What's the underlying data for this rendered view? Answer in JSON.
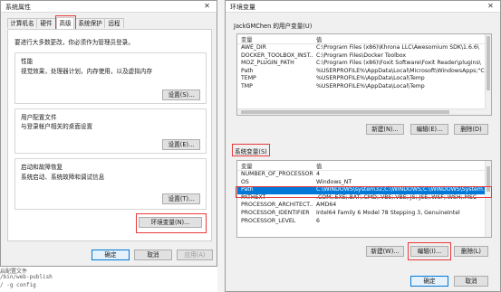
{
  "sysprops": {
    "title": "系统属性",
    "close_glyph": "✕",
    "tabs": [
      "计算机名",
      "硬件",
      "高级",
      "系统保护",
      "远程"
    ],
    "admin_note": "要进行大多数更改，你必须作为管理员登录。",
    "performance": {
      "title": "性能",
      "desc": "视觉效果，处理器计划，内存使用，以及虚拟内存",
      "button": "设置(S)..."
    },
    "profile": {
      "title": "用户配置文件",
      "desc": "与登录帐户相关的桌面设置",
      "button": "设置(E)..."
    },
    "startup": {
      "title": "启动和故障恢复",
      "desc": "系统启动、系统故障和调试信息",
      "button": "设置(T)..."
    },
    "env_button": "环境变量(N)...",
    "ok": "确定",
    "cancel": "取消",
    "apply": "应用(A)"
  },
  "envvars": {
    "title": "环境变量",
    "close_glyph": "✕",
    "user_section": "JackGMChen 的用户变量(U)",
    "col_var": "变量",
    "col_val": "值",
    "user_rows": [
      {
        "name": "AWE_DIR",
        "value": "C:\\Program Files (x86)\\Khrona LLC\\Awesomium SDK\\1.6.6\\"
      },
      {
        "name": "DOCKER_TOOLBOX_INST...",
        "value": "C:\\Program Files\\Docker Toolbox"
      },
      {
        "name": "MOZ_PLUGIN_PATH",
        "value": "C:\\Program Files (x86)\\Foxit Software\\Foxit Reader\\plugins\\"
      },
      {
        "name": "Path",
        "value": "%USERPROFILE%\\AppData\\Local\\Microsoft\\WindowsApps;\"C:\\"
      },
      {
        "name": "TEMP",
        "value": "%USERPROFILE%\\AppData\\Local\\Temp"
      },
      {
        "name": "TMP",
        "value": "%USERPROFILE%\\AppData\\Local\\Temp"
      }
    ],
    "user_new": "新建(N)...",
    "user_edit": "编辑(E)...",
    "user_delete": "删除(D)",
    "system_section": "系统变量(S)",
    "sys_rows": [
      {
        "name": "NUMBER_OF_PROCESSORS",
        "value": "4"
      },
      {
        "name": "OS",
        "value": "Windows_NT"
      },
      {
        "name": "Path",
        "value": "C:\\WINDOWS\\system32;C:\\WINDOWS;C:\\WINDOWS\\System..."
      },
      {
        "name": "PATHEXT",
        "value": ".COM;.EXE;.BAT;.CMD;.VBS;.VBE;.JS;.JSE;.WSF;.WSH;.MSC"
      },
      {
        "name": "PROCESSOR_ARCHITECT...",
        "value": "AMD64"
      },
      {
        "name": "PROCESSOR_IDENTIFIER",
        "value": "Intel64 Family 6 Model 78 Stepping 3, GenuineIntel"
      },
      {
        "name": "PROCESSOR_LEVEL",
        "value": "6"
      }
    ],
    "sys_new": "新建(W)...",
    "sys_edit": "编辑(I)...",
    "sys_delete": "删除(L)",
    "ok": "确定",
    "cancel": "取消"
  },
  "background_text": {
    "line1": "启配置文件",
    "line2": "/bin/web-publish",
    "line3": "/ -g config"
  },
  "colors": {
    "highlight": "#0078d7",
    "annotation": "#e83a3a"
  }
}
